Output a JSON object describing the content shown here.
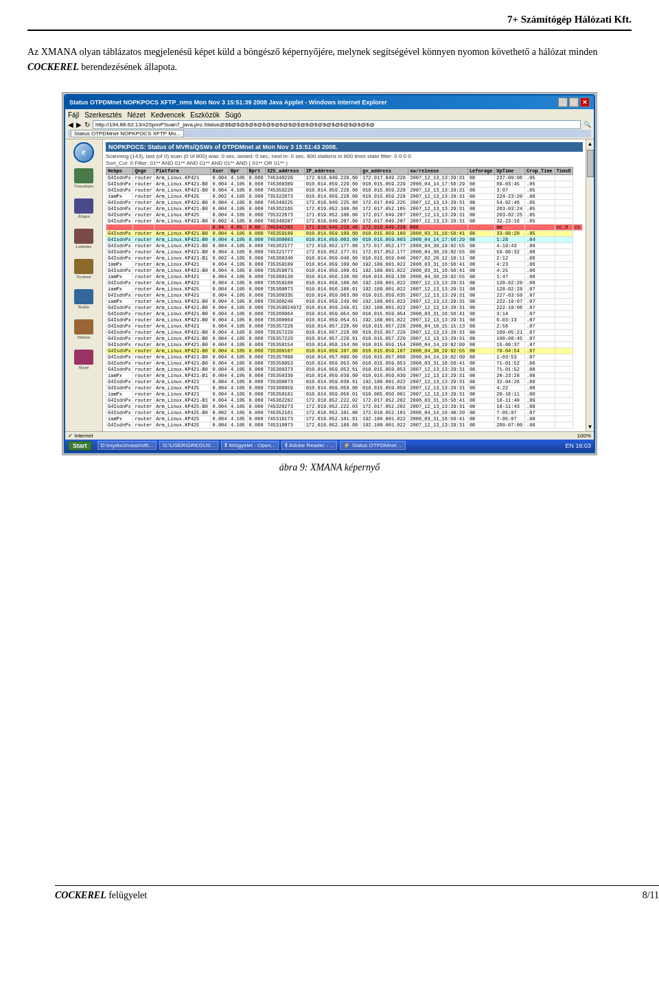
{
  "header": {
    "title": "7+ Számítógép Hálózati Kft."
  },
  "intro": {
    "text_before": "Az XMANA olyan táblázatos megjelenésű képet küld a böngésző képernyőjére, melynek segítségével könnyen nyomon követhető a hálózat minden ",
    "brand": "COCKEREL",
    "text_after": " berendezésének állapota."
  },
  "browser_window": {
    "title": "Status OTPDMnet NOPKPOCS XFTP_nms Mon Nov 3 15:51:39 2008 Java Applet - Windows Internet Explorer",
    "address": "http://194.88.62.13/x2SproPSuan7_java.pro.Status@$$@$@$@$@$@$@$@$@$@$@$@$@$@$@$@$@$@",
    "menu_items": [
      "Fájl",
      "Szerkesztés",
      "Nézet",
      "Kedvencek",
      "Eszközök",
      "Súgó"
    ],
    "status_title": "Status OTPDMnet NOPKPOCS XFTP Mo...",
    "nms_status": "NOPKPOCS: Status of MVRs/QSWs of OTPDMnet at Mon Nov 3 15:51:43 2008.",
    "scan_info": "Scanning (143), last (of 0) scan (0 of 800) was: 0 sec, lasted: 0 sec, next in: 0 sec.  800 stations in 800 lines  state filter: 0 0 0 0",
    "filter_line": "Sort_Col: 0  Filter: 01** AND 01** AND 01** AND 01** AND ( 01** OR 01** )",
    "columns": [
      "Hebpo",
      "Qnge",
      "Platform",
      "Xser",
      "Bpr",
      "Bprt",
      "X25_address",
      "IP_address",
      "gv_address",
      "sw/release",
      "Leforage",
      "UpTime",
      "Crop_Time",
      "TimsD"
    ],
    "rows": [
      {
        "class": "row-white",
        "cols": [
          "G4IsdnPx",
          "router",
          "Arm_Linux.KP421",
          "0.004",
          "4.105",
          "0.060",
          "745340228",
          "172.018.049.228.60",
          "172.017.049.228",
          "2007_12_13_13:29:31",
          "08",
          "237-09:06",
          ".05",
          ""
        ]
      },
      {
        "class": "row-white",
        "cols": [
          "G4IsdnPx",
          "router",
          "Arm_Linux.KP421-B0",
          "0.004",
          "4.105",
          "0.060",
          "745360309",
          "010.014.059.229.60",
          "010.015.059.229",
          "2006_04_14_17:56:29",
          "08",
          "69-03:45",
          ".05",
          ""
        ]
      },
      {
        "class": "row-white",
        "cols": [
          "G4IsdnPx",
          "router",
          "Arm_Linux.KP421-B0",
          "0.004",
          "4.105",
          "0.060",
          "745350228",
          "010.014.059.228.60",
          "010.015.059.228",
          "2007_12_13_13:29:31",
          "08",
          "3:07",
          ".05",
          ""
        ]
      },
      {
        "class": "row-white",
        "cols": [
          "iamPx",
          "router",
          "Arm_Linux.KP425",
          "0.002",
          "4.105",
          "0.060",
          "735322673",
          "010.014.059.228.60",
          "010.015.059.228",
          "2007_12_13_13:29:31",
          "08",
          "224-23:20",
          ".06",
          ""
        ]
      },
      {
        "class": "row-white",
        "cols": [
          "G4IsdnPx",
          "router",
          "Arm_Linux.KP421-B0",
          "0.004",
          "4.105",
          "0.060",
          "745349225",
          "172.018.049.225.60",
          "172.017.049.225",
          "2007_12_13_13:29:31",
          "08",
          "54-02:46",
          ".05",
          ""
        ]
      },
      {
        "class": "row-white",
        "cols": [
          "G4IsdnPx",
          "router",
          "Arm_Linux.KP421-B0",
          "0.004",
          "4.105",
          "0.060",
          "745362165",
          "172.019.052.108.60",
          "172.017.052.165",
          "2007_12_13_13:29:31",
          "08",
          "263-03:24",
          ".05",
          ""
        ]
      },
      {
        "class": "row-white",
        "cols": [
          "G4IsdnPx",
          "router",
          "Arm_Linux.KP425",
          "0.004",
          "4.105",
          "0.060",
          "735322673",
          "171.019.052.108.60",
          "172.017.049.207",
          "2007_12_13_13:29:31",
          "08",
          "263-02:25",
          ".05",
          ""
        ]
      },
      {
        "class": "row-white",
        "cols": [
          "G4IsdnPx",
          "router",
          "Arm_Linux.KP421-B0",
          "0.002",
          "4.105",
          "0.060",
          "745340207",
          "172.018.049.207.60",
          "172.017.049.207",
          "2007_12_13_13:29:31",
          "08",
          "32-23:16",
          ".05",
          ""
        ]
      },
      {
        "class": "row-red",
        "cols": [
          "",
          "",
          "",
          "0.04",
          "4.05",
          "0.06",
          "745342202",
          "171.018.049.228.40",
          "172.018.049.228",
          "006",
          "",
          "dm",
          "",
          "cc_0",
          "cc"
        ]
      },
      {
        "class": "row-yellow",
        "cols": [
          "G4IsdnPx",
          "router",
          "Arm_Linux.KP421-B0",
          "0.004",
          "4.105",
          "0.060",
          "745359109",
          "010.014.059.109.60",
          "010.015.059.109",
          "2006_03_31_16:56:41",
          "08",
          "33-08:20",
          ".05",
          ""
        ]
      },
      {
        "class": "row-cyan",
        "cols": [
          "G4IsdnPx",
          "router",
          "Arm_Linux.KP421-B0",
          "0.004",
          "4.105",
          "0.060",
          "745360003",
          "010.014.059.003.60",
          "010.015.059.003",
          "2006_04_14_17:56:29",
          "08",
          "1:28",
          ".04",
          ""
        ]
      },
      {
        "class": "row-white",
        "cols": [
          "G4IsdnPx",
          "router",
          "Arm_Linux.KP421-B0",
          "0.004",
          "4.105",
          "0.060",
          "745362177",
          "172.019.052.177.60",
          "172.017.052.177",
          "2006_04_30_19:02:55",
          "08",
          "4-19:43",
          ".06",
          ""
        ]
      },
      {
        "class": "row-white",
        "cols": [
          "G4IsdnPx",
          "router",
          "Arm_Linux.KP421-B0",
          "0.004",
          "4.105",
          "0.060",
          "745321777",
          "172.019.052.177.61",
          "172.017.052.177",
          "2006_04_30_19:02:55",
          "08",
          "59-09:32",
          ".06",
          ""
        ]
      },
      {
        "class": "row-white",
        "cols": [
          "G4IsdnPx",
          "router",
          "Arm_Linux.KP421-B1",
          "0.002",
          "4.105",
          "0.060",
          "745360346",
          "010.014.059.048.60",
          "010.015.059.046",
          "2007_02_20_12:10:11",
          "08",
          "2:12",
          ".06",
          ""
        ]
      },
      {
        "class": "row-white",
        "cols": [
          "iamPx",
          "router",
          "Arm_Linux.KP421",
          "0.004",
          "4.105",
          "0.060",
          "735359109",
          "010.014.059.109.60",
          "192.180.001.022",
          "2006_03_31_16:56:41",
          "08",
          "4:23",
          ".06",
          ""
        ]
      },
      {
        "class": "row-white",
        "cols": [
          "G4IsdnPx",
          "router",
          "Arm_Linux.KP421-B0",
          "0.004",
          "4.105",
          "0.060",
          "735359073",
          "010.014.059.109.61",
          "192.189.001.022",
          "2006_03_31_16:56:41",
          "08",
          "4:25",
          ".06",
          ""
        ]
      },
      {
        "class": "row-white",
        "cols": [
          "iamPx",
          "router",
          "Arm_Linux.KP421",
          "0.004",
          "4.105",
          "0.060",
          "735360130",
          "010.014.056.130.60",
          "010.015.059.130",
          "2006_04_30_19:02:55",
          "08",
          "1:47",
          ".06",
          ""
        ]
      },
      {
        "class": "row-white",
        "cols": [
          "G4IsdnPx",
          "router",
          "Arm_Linux.KP421",
          "0.004",
          "4.105",
          "0.060",
          "735358160",
          "010.014.058.160.60",
          "192.189.001.022",
          "2007_12_13_13:29:31",
          "08",
          "120-02:20",
          ".06",
          ""
        ]
      },
      {
        "class": "row-white",
        "cols": [
          "iamPx",
          "router",
          "Arm_Linux.KP425",
          "0.004",
          "4.105",
          "0.060",
          "735360073",
          "010.014.056.180.61",
          "192.189.001.022",
          "2007_12_13_13:29:31",
          "08",
          "128-02:28",
          ".07",
          ""
        ]
      },
      {
        "class": "row-white",
        "cols": [
          "G4IsdnPx",
          "router",
          "Arm_Linux.KP421",
          "0.004",
          "4.105",
          "0.060",
          "735360335",
          "010.014.059.063.60",
          "010.015.659.635",
          "2007_12_13_13:29:31",
          "08",
          "227-03:50",
          ".07",
          ""
        ]
      },
      {
        "class": "row-white",
        "cols": [
          "iamPx",
          "router",
          "Arm_Linux.KP421-B0",
          "0.004",
          "4.105",
          "0.060",
          "735360249",
          "010.014.059.249.60",
          "192.188.001.022",
          "2007_12_13_13:29:31",
          "08",
          "222-19:07",
          ".07",
          ""
        ]
      },
      {
        "class": "row-white",
        "cols": [
          "G4IsdnPx",
          "router",
          "Arm_Linux.KP421-B0",
          "0.004",
          "4.105",
          "0.060",
          "735359024972",
          "010.014.059.249.61",
          "192.188.001.022",
          "2007_12_13_13:29:31",
          "08",
          "222-19:06",
          ".07",
          ""
        ]
      },
      {
        "class": "row-white",
        "cols": [
          "G4IsdnPx",
          "router",
          "Arm_Linux.KP421-B0",
          "0.004",
          "4.105",
          "0.060",
          "735360964",
          "010.014.059.054.60",
          "010.015.659.054",
          "2006_03_31_16:56:41",
          "08",
          "3:14",
          ".07",
          ""
        ]
      },
      {
        "class": "row-white",
        "cols": [
          "G4IsdnPx",
          "router",
          "Arm_Linux.KP421-B0",
          "0.004",
          "4.105",
          "0.060",
          "735360064",
          "010.014.059.054.61",
          "192.188.001.022",
          "2007_12_13_13:29:31",
          "08",
          "6-03:13",
          ".07",
          ""
        ]
      },
      {
        "class": "row-white",
        "cols": [
          "G4IsdnPx",
          "router",
          "Arm_Linux.KP421",
          "0.004",
          "4.105",
          "0.060",
          "735357228",
          "010.014.057.228.60",
          "010.015.057.228",
          "2006_04_10_15:15:13",
          "08",
          "2:56",
          ".07",
          ""
        ]
      },
      {
        "class": "row-white",
        "cols": [
          "G4IsdnPx",
          "router",
          "Arm_Linux.KP421-B0",
          "0.004",
          "4.105",
          "0.060",
          "735357229",
          "010.014.057.229.60",
          "010.015.057.229",
          "2007_12_13_13:29:31",
          "08",
          "169-05:21",
          ".07",
          ""
        ]
      },
      {
        "class": "row-white",
        "cols": [
          "G4IsdnPx",
          "router",
          "Arm_Linux.KP421-B0",
          "0.004",
          "4.105",
          "0.060",
          "735357229",
          "010.014.057.229.61",
          "010.015.057.229",
          "2007_12_13_13:29:31",
          "08",
          "160-08:45",
          ".07",
          ""
        ]
      },
      {
        "class": "row-white",
        "cols": [
          "G4IsdnPx",
          "router",
          "Arm_Linux.KP421-B0",
          "0.004",
          "4.105",
          "0.060",
          "735358154",
          "010.014.058.154.60",
          "010.015.059.154",
          "2006_04_14_19:02:09",
          "08",
          "15-09:37",
          ".07",
          ""
        ]
      },
      {
        "class": "row-yellow",
        "cols": [
          "G4IsdnPx",
          "router",
          "Arm_Linux.KP421-B0",
          "0.004",
          "4.105",
          "0.060",
          "735360107",
          "010.014.059.107.60",
          "010.015.059.107",
          "2006_04_30_19:02:55",
          "08",
          "70-04:54",
          ".07",
          ""
        ]
      },
      {
        "class": "row-white",
        "cols": [
          "G4IsdnPx",
          "router",
          "Arm_Linux.KP421-B0",
          "0.004",
          "4.105",
          "0.060",
          "735357098",
          "010.014.057.098.60",
          "010.015.057.098",
          "2006_04_14_19:02:09",
          "08",
          "1-03:53",
          ".07",
          ""
        ]
      },
      {
        "class": "row-white",
        "cols": [
          "G4IsdnPx",
          "router",
          "Arm_Linux.KP421-B0",
          "0.004",
          "4.105",
          "0.060",
          "735350953",
          "010.014.059.053.60",
          "010.015.059.053",
          "2006_03_31_16:56:41",
          "08",
          "71-01:52",
          ".06",
          ""
        ]
      },
      {
        "class": "row-white",
        "cols": [
          "G4IsdnPx",
          "router",
          "Arm_Linux.KP421-B0",
          "0.004",
          "4.105",
          "0.060",
          "735360373",
          "010.014.059.053.61",
          "010.015.059.053",
          "2007_12_13_13:29:31",
          "08",
          "71-01:52",
          ".06",
          ""
        ]
      },
      {
        "class": "row-white",
        "cols": [
          "iamPx",
          "router",
          "Arm_Linux.KP421-B1",
          "0.004",
          "4.105",
          "0.060",
          "735350339",
          "010.014.059.039.60",
          "010.015.059.039",
          "2007_12_13_13:29:31",
          "08",
          "20-23:28",
          ".08",
          ""
        ]
      },
      {
        "class": "row-white",
        "cols": [
          "G4IsdnPx",
          "router",
          "Arm_Linux.KP421",
          "0.004",
          "4.105",
          "0.060",
          "735360073",
          "010.014.059.039.61",
          "192.180.001.022",
          "2007_12_13_13:29:31",
          "08",
          "32-04:26",
          ".06",
          ""
        ]
      },
      {
        "class": "row-white",
        "cols": [
          "G4IsdnPx",
          "router",
          "Arm_Linux.KP425",
          "0.004",
          "4.105",
          "0.060",
          "735360959",
          "010.014.059.059.60",
          "010.015.059.059",
          "2007_12_13_13:29:31",
          "08",
          "4:22",
          ".06",
          ""
        ]
      },
      {
        "class": "row-white",
        "cols": [
          "iamPx",
          "router",
          "Arm_Linux.KP421",
          "0.004",
          "4.105",
          "0.060",
          "735350101",
          "010.014.059.050.01",
          "010.085.050.001",
          "2007_12_13_13:29:31",
          "08",
          "20-18:11",
          ".06",
          ""
        ]
      },
      {
        "class": "row-white",
        "cols": [
          "G4IsdnPx",
          "router",
          "Arm_Linux.KP421-B1",
          "0.004",
          "4.105",
          "0.060",
          "745362202",
          "172.018.052.222.02",
          "172.017.052.202",
          "2006_03_31_16:56:41",
          "08",
          "10-11:40",
          ".09",
          ""
        ]
      },
      {
        "class": "row-white",
        "cols": [
          "G4IsdnPx",
          "router",
          "Arm_Linux.KP425-B0",
          "0.004",
          "4.105",
          "0.060",
          "745320273",
          "172.019.052.222.03",
          "172.017.052.202",
          "2007_12_13_13:29:31",
          "08",
          "18-11:43",
          ".08",
          ""
        ]
      },
      {
        "class": "row-white",
        "cols": [
          "G4IsdnPx",
          "router",
          "Arm_Linux.KP425-B0",
          "0.002",
          "4.105",
          "0.060",
          "745352161",
          "172.018.052.101.80",
          "172.018.052.101",
          "2006_04_14_16:48:20",
          "08",
          "7-05:07",
          ".07",
          ""
        ]
      },
      {
        "class": "row-white",
        "cols": [
          "iamPx",
          "router",
          "Arm_Linux.KP425",
          "0.004",
          "4.105",
          "0.060",
          "745316173",
          "172.019.052.101.61",
          "192.180.001.022",
          "2006_03_31_16:56:41",
          "08",
          "7-05:07",
          ".08",
          ""
        ]
      },
      {
        "class": "row-white",
        "cols": [
          "G4IsdnPx",
          "router",
          "Arm_Linux.KP425",
          "0.004",
          "4.105",
          "0.060",
          "745316073",
          "172.018.052.189.60",
          "192.180.001.022",
          "2007_12_13_13:29:31",
          "08",
          "260-07:00",
          ".08",
          ""
        ]
      }
    ]
  },
  "taskbar": {
    "start": "Start",
    "items": [
      "D:\\mydocs\\vaas\\ofti...",
      "G:\\USER\\GREGUS...",
      "Ⅱ felügyelet - Open...",
      "Ⅱ Adobe Reader - ...",
      "⚡ Status OTPDMnet ..."
    ],
    "clock": "EN  16:03",
    "pct": "100%"
  },
  "caption": "ábra 9: XMANA képernyő",
  "footer": {
    "brand": "COCKEREL",
    "suffix": " felügyelet",
    "page": "8/11"
  }
}
